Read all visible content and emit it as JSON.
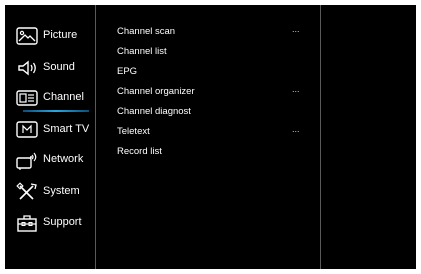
{
  "sidebar": {
    "items": [
      {
        "label": "Picture",
        "icon": "picture-icon"
      },
      {
        "label": "Sound",
        "icon": "speaker-icon"
      },
      {
        "label": "Channel",
        "icon": "channel-icon",
        "active": true
      },
      {
        "label": "Smart TV",
        "icon": "smart-tv-icon"
      },
      {
        "label": "Network",
        "icon": "network-icon"
      },
      {
        "label": "System",
        "icon": "tools-icon"
      },
      {
        "label": "Support",
        "icon": "toolbox-icon"
      }
    ]
  },
  "submenu": {
    "items": [
      {
        "label": "Channel scan",
        "more": "..."
      },
      {
        "label": "Channel list",
        "more": ""
      },
      {
        "label": "EPG",
        "more": ""
      },
      {
        "label": "Channel organizer",
        "more": "..."
      },
      {
        "label": "Channel diagnost",
        "more": ""
      },
      {
        "label": "Teletext",
        "more": "..."
      },
      {
        "label": "Record list",
        "more": ""
      }
    ]
  },
  "colors": {
    "background": "#000000",
    "text": "#ffffff",
    "accent": "#28a8e0",
    "divider": "#5a5a5a"
  }
}
